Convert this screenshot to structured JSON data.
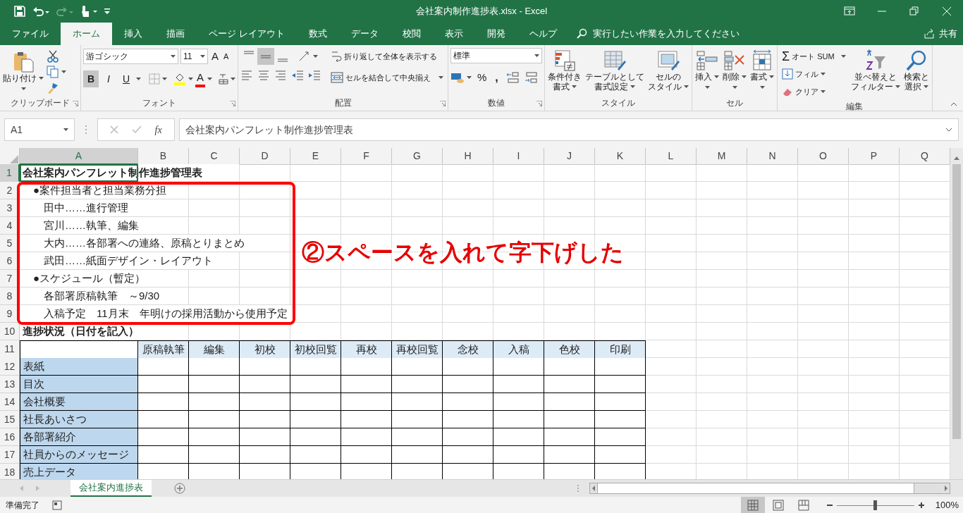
{
  "window": {
    "title": "会社案内制作進捗表.xlsx  -  Excel"
  },
  "ribbon_tabs": [
    {
      "label": "ファイル",
      "selected": false
    },
    {
      "label": "ホーム",
      "selected": true
    },
    {
      "label": "挿入",
      "selected": false
    },
    {
      "label": "描画",
      "selected": false
    },
    {
      "label": "ページ レイアウト",
      "selected": false
    },
    {
      "label": "数式",
      "selected": false
    },
    {
      "label": "データ",
      "selected": false
    },
    {
      "label": "校閲",
      "selected": false
    },
    {
      "label": "表示",
      "selected": false
    },
    {
      "label": "開発",
      "selected": false
    },
    {
      "label": "ヘルプ",
      "selected": false
    }
  ],
  "tell_me": {
    "placeholder": "実行したい作業を入力してください"
  },
  "share": "共有",
  "ribbon": {
    "groups": [
      {
        "kind": "clipboard",
        "label": "クリップボード",
        "paste": "貼り付け"
      },
      {
        "kind": "font",
        "label": "フォント",
        "font_name": "游ゴシック",
        "font_size": "11",
        "grow": "A",
        "shrink": "A",
        "styles": [
          {
            "label": "B",
            "on": true
          },
          {
            "label": "I",
            "on": false
          },
          {
            "label": "U",
            "on": false
          }
        ],
        "font_color": "A"
      },
      {
        "kind": "alignment",
        "label": "配置",
        "vertical": [
          {
            "selected": false
          },
          {
            "selected": true
          },
          {
            "selected": false
          }
        ],
        "wrap": "折り返して全体を表示する",
        "merge": "セルを結合して中央揃え"
      },
      {
        "kind": "number",
        "label": "数値",
        "format": "標準",
        "percent": "%",
        "comma": ","
      },
      {
        "kind": "styles",
        "label": "スタイル",
        "buttons": [
          {
            "kind": "conditional",
            "lines": [
              "条件付き",
              "書式"
            ]
          },
          {
            "kind": "table",
            "lines": [
              "テーブルとして",
              "書式設定"
            ]
          },
          {
            "kind": "cell_styles",
            "lines": [
              "セルの",
              "スタイル"
            ]
          }
        ]
      },
      {
        "kind": "cells",
        "label": "セル",
        "buttons": [
          {
            "kind": "insert",
            "lines": [
              "挿入"
            ]
          },
          {
            "kind": "delete",
            "lines": [
              "削除"
            ]
          },
          {
            "kind": "format",
            "lines": [
              "書式"
            ]
          }
        ]
      },
      {
        "kind": "editing",
        "label": "編集",
        "sigma": "Σ",
        "autosum": "オート SUM",
        "fill": "フィル",
        "clear": "クリア",
        "buttons": [
          {
            "kind": "sort",
            "lines": [
              "並べ替えと",
              "フィルター"
            ]
          },
          {
            "kind": "find",
            "lines": [
              "検索と",
              "選択"
            ]
          }
        ]
      }
    ]
  },
  "formula_bar": {
    "name_box": "A1",
    "fx": "fx",
    "content": "会社案内パンフレット制作進捗管理表"
  },
  "sheet": {
    "columns": [
      {
        "label": "A",
        "selected": true
      },
      {
        "label": "B",
        "selected": false
      },
      {
        "label": "C",
        "selected": false
      },
      {
        "label": "D",
        "selected": false
      },
      {
        "label": "E",
        "selected": false
      },
      {
        "label": "F",
        "selected": false
      },
      {
        "label": "G",
        "selected": false
      },
      {
        "label": "H",
        "selected": false
      },
      {
        "label": "I",
        "selected": false
      },
      {
        "label": "J",
        "selected": false
      },
      {
        "label": "K",
        "selected": false
      },
      {
        "label": "L",
        "selected": false
      },
      {
        "label": "M",
        "selected": false
      },
      {
        "label": "N",
        "selected": false
      },
      {
        "label": "O",
        "selected": false
      },
      {
        "label": "P",
        "selected": false
      },
      {
        "label": "Q",
        "selected": false
      }
    ],
    "rows": [
      {
        "number": "1",
        "selected": true,
        "kind": "text",
        "text": "会社案内パンフレット制作進捗管理表",
        "bold": true
      },
      {
        "number": "2",
        "selected": false,
        "kind": "text",
        "text": "　●案件担当者と担当業務分担",
        "bold": false
      },
      {
        "number": "3",
        "selected": false,
        "kind": "text",
        "text": "　　田中……進行管理",
        "bold": false
      },
      {
        "number": "4",
        "selected": false,
        "kind": "text",
        "text": "　　宮川……執筆、編集",
        "bold": false
      },
      {
        "number": "5",
        "selected": false,
        "kind": "text",
        "text": "　　大内……各部署への連絡、原稿とりまとめ",
        "bold": false
      },
      {
        "number": "6",
        "selected": false,
        "kind": "text",
        "text": "　　武田……紙面デザイン・レイアウト",
        "bold": false
      },
      {
        "number": "7",
        "selected": false,
        "kind": "text",
        "text": "　●スケジュール（暫定）",
        "bold": false
      },
      {
        "number": "8",
        "selected": false,
        "kind": "text",
        "text": "　　各部署原稿執筆　～9/30",
        "bold": false
      },
      {
        "number": "9",
        "selected": false,
        "kind": "text",
        "text": "　　入稿予定　11月末　年明けの採用活動から使用予定",
        "bold": false
      },
      {
        "number": "10",
        "selected": false,
        "kind": "text",
        "text": "進捗状況（日付を記入）",
        "bold": true
      },
      {
        "number": "11",
        "selected": false,
        "kind": "table_header",
        "headers": [
          "原稿執筆",
          "編集",
          "初校",
          "初校回覧",
          "再校",
          "再校回覧",
          "念校",
          "入稿",
          "色校",
          "印刷"
        ]
      },
      {
        "number": "12",
        "selected": false,
        "kind": "table_row",
        "label": "表紙"
      },
      {
        "number": "13",
        "selected": false,
        "kind": "table_row",
        "label": "目次"
      },
      {
        "number": "14",
        "selected": false,
        "kind": "table_row",
        "label": "会社概要"
      },
      {
        "number": "15",
        "selected": false,
        "kind": "table_row",
        "label": "社長あいさつ"
      },
      {
        "number": "16",
        "selected": false,
        "kind": "table_row",
        "label": "各部署紹介"
      },
      {
        "number": "17",
        "selected": false,
        "kind": "table_row",
        "label": "社員からのメッセージ"
      },
      {
        "number": "18",
        "selected": false,
        "kind": "table_row",
        "label": "売上データ"
      }
    ]
  },
  "annotation": {
    "text": "②スペースを入れて字下げした"
  },
  "sheet_tabs": [
    {
      "label": "会社案内進捗表",
      "selected": true
    }
  ],
  "status_bar": {
    "text": "準備完了",
    "views": [
      {
        "kind": "normal",
        "selected": true
      },
      {
        "kind": "page_layout",
        "selected": false
      },
      {
        "kind": "page_break",
        "selected": false
      }
    ],
    "zoom": {
      "level": 0.5
    },
    "zoom_text": "100%"
  }
}
